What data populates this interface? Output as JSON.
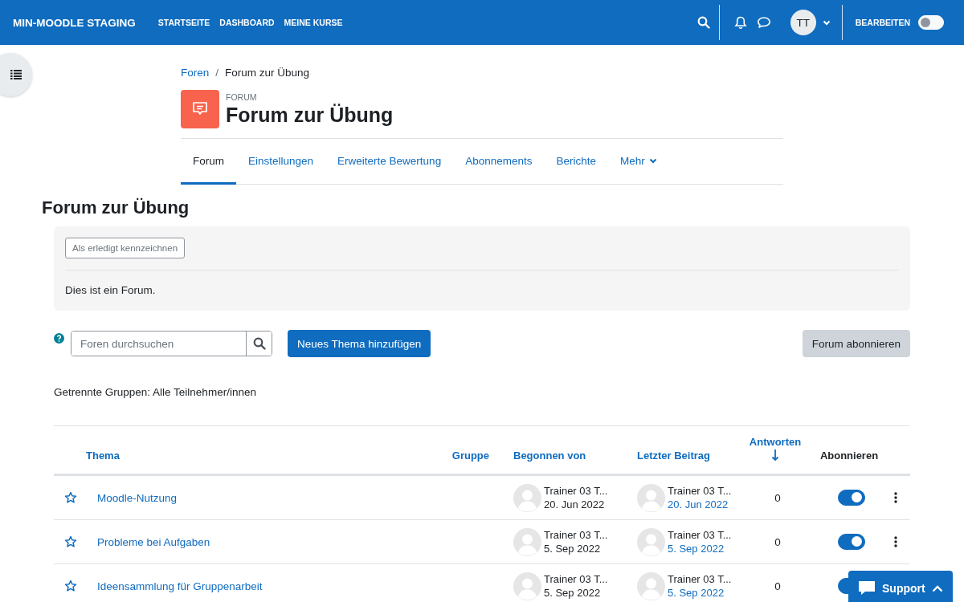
{
  "navbar": {
    "site_name": "MIN-MOODLE STAGING",
    "links": [
      "STARTSEITE",
      "DASHBOARD",
      "MEINE KURSE"
    ],
    "user_initials": "TT",
    "edit_label": "BEARBEITEN",
    "edit_on": false
  },
  "breadcrumb": [
    "Foren",
    "/",
    "Forum zur Übung"
  ],
  "activity": {
    "type_label": "FORUM",
    "title": "Forum zur Übung"
  },
  "tabs": [
    {
      "label": "Forum",
      "selected": true,
      "dropdown": false
    },
    {
      "label": "Einstellungen",
      "selected": false,
      "dropdown": false
    },
    {
      "label": "Erweiterte Bewertung",
      "selected": false,
      "dropdown": false
    },
    {
      "label": "Abonnements",
      "selected": false,
      "dropdown": false
    },
    {
      "label": "Berichte",
      "selected": false,
      "dropdown": false
    },
    {
      "label": "Mehr",
      "selected": false,
      "dropdown": true
    }
  ],
  "page_title": "Forum zur Übung",
  "completion_button": "Als erledigt kennzeichnen",
  "description": "Dies ist ein Forum.",
  "search": {
    "placeholder": "Foren durchsuchen"
  },
  "add_button": "Neues Thema hinzufügen",
  "subscribe_button": "Forum abonnieren",
  "group_mode": "Getrennte Gruppen: Alle Teilnehmer/innen",
  "table": {
    "columns": [
      {
        "label": "Thema",
        "kind": "link"
      },
      {
        "label": "Gruppe",
        "kind": "link"
      },
      {
        "label": "Begonnen von",
        "kind": "link"
      },
      {
        "label": "Letzter Beitrag",
        "kind": "link"
      },
      {
        "label": "Antworten",
        "kind": "sorted"
      },
      {
        "label": "Abonnieren",
        "kind": "plain"
      }
    ],
    "rows": [
      {
        "starred": false,
        "topic": "Moodle-Nutzung",
        "started_by": "Trainer 03 T...",
        "started_on": "20. Jun 2022",
        "last_by": "Trainer 03 T...",
        "last_on": "20. Jun 2022",
        "replies": "0",
        "subscribed": true
      },
      {
        "starred": false,
        "topic": "Probleme bei Aufgaben",
        "started_by": "Trainer 03 T...",
        "started_on": "5. Sep 2022",
        "last_by": "Trainer 03 T...",
        "last_on": "5. Sep 2022",
        "replies": "0",
        "subscribed": true
      },
      {
        "starred": false,
        "topic": "Ideensammlung für Gruppenarbeit",
        "started_by": "Trainer 03 T...",
        "started_on": "5. Sep 2022",
        "last_by": "Trainer 03 T...",
        "last_on": "5. Sep 2022",
        "replies": "0",
        "subscribed": true
      }
    ]
  },
  "support_button": "Support"
}
